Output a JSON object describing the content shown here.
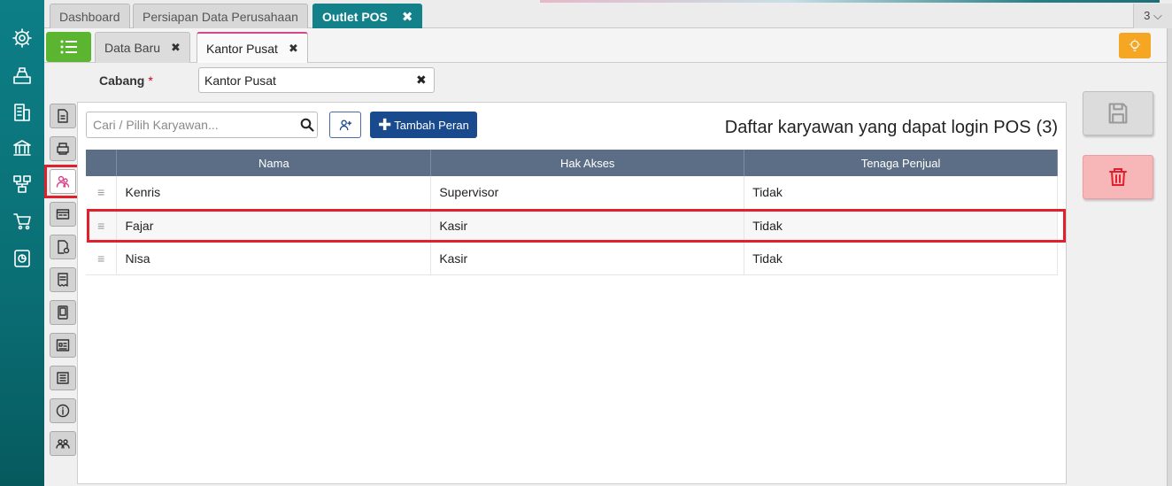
{
  "top_tabs": [
    {
      "label": "Dashboard",
      "active": false
    },
    {
      "label": "Persiapan Data Perusahaan",
      "active": false
    },
    {
      "label": "Outlet POS",
      "active": true,
      "close": "✖"
    }
  ],
  "tab_count": "3 ⌵",
  "sub_tabs": [
    {
      "label": "Data Baru",
      "close": "✖"
    },
    {
      "label": "Kantor Pusat",
      "close": "✖",
      "active": true
    }
  ],
  "branch": {
    "label": "Cabang",
    "required": "*",
    "value": "Kantor Pusat",
    "clear": "✖"
  },
  "search": {
    "placeholder": "Cari / Pilih Karyawan..."
  },
  "add_role_label": "Tambah Peran",
  "add_role_plus": "✚",
  "list": {
    "title": "Daftar karyawan yang dapat login POS",
    "count": "(3)"
  },
  "table": {
    "columns": [
      "Nama",
      "Hak Akses",
      "Tenaga Penjual"
    ],
    "rows": [
      {
        "handle": "≡",
        "name": "Kenris",
        "role": "Supervisor",
        "sales": "Tidak"
      },
      {
        "handle": "≡",
        "name": "Fajar",
        "role": "Kasir",
        "sales": "Tidak"
      },
      {
        "handle": "≡",
        "name": "Nisa",
        "role": "Kasir",
        "sales": "Tidak"
      }
    ]
  },
  "colors": {
    "rail": "#0d7e86",
    "active_tab": "#13818a",
    "menu_button": "#5bb531",
    "primary_button": "#1a4a8e",
    "table_header": "#5b6e85",
    "highlight": "#e0202c",
    "delete_button": "#f7b6b8",
    "bulb_button": "#f5a623"
  },
  "icons": {
    "rail": [
      "gear-icon",
      "cashier-icon",
      "building-icon",
      "bank-icon",
      "network-icon",
      "cart-icon",
      "report-icon"
    ],
    "tools": [
      "document-icon",
      "printer-icon",
      "users-icon",
      "form-icon",
      "settings-doc-icon",
      "receipt-icon",
      "tablet-icon",
      "display-icon",
      "list-icon",
      "info-icon",
      "group-icon"
    ]
  }
}
